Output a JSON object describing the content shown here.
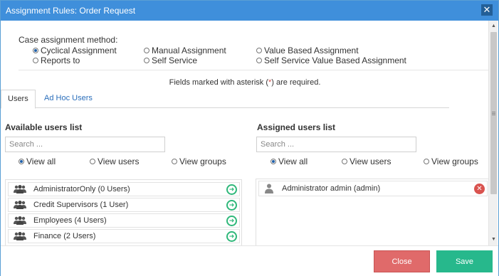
{
  "dialog": {
    "title": "Assignment Rules: Order Request",
    "close_glyph": "✕"
  },
  "method": {
    "label": "Case assignment method:",
    "options": [
      {
        "label": "Cyclical Assignment",
        "checked": true
      },
      {
        "label": "Manual Assignment",
        "checked": false
      },
      {
        "label": "Value Based Assignment",
        "checked": false
      },
      {
        "label": "Reports to",
        "checked": false
      },
      {
        "label": "Self Service",
        "checked": false
      },
      {
        "label": "Self Service Value Based Assignment",
        "checked": false
      }
    ]
  },
  "required_note": {
    "before": "Fields marked with asterisk (",
    "asterisk": "*",
    "after": ") are required."
  },
  "tabs": [
    {
      "label": "Users",
      "active": true
    },
    {
      "label": "Ad Hoc Users",
      "active": false
    }
  ],
  "available": {
    "title": "Available users list",
    "search_placeholder": "Search ...",
    "filters": [
      {
        "label": "View all",
        "checked": true
      },
      {
        "label": "View users",
        "checked": false
      },
      {
        "label": "View groups",
        "checked": false
      }
    ],
    "items": [
      {
        "label": "AdministratorOnly (0 Users)",
        "icon": "users-group-icon"
      },
      {
        "label": "Credit Supervisors (1 User)",
        "icon": "users-group-icon"
      },
      {
        "label": "Employees (4 Users)",
        "icon": "users-group-icon"
      },
      {
        "label": "Finance (2 Users)",
        "icon": "users-group-icon"
      }
    ],
    "add_glyph": "➜"
  },
  "assigned": {
    "title": "Assigned users list",
    "search_placeholder": "Search ...",
    "filters": [
      {
        "label": "View all",
        "checked": true
      },
      {
        "label": "View users",
        "checked": false
      },
      {
        "label": "View groups",
        "checked": false
      }
    ],
    "items": [
      {
        "label": "Administrator admin (admin)",
        "icon": "user-icon"
      }
    ],
    "remove_glyph": "✕"
  },
  "scrollbar": {
    "up_glyph": "▲",
    "down_glyph": "▼"
  },
  "footer": {
    "close_label": "Close",
    "save_label": "Save"
  },
  "colors": {
    "titlebar": "#3f8fdb",
    "close_button": "#e06a6a",
    "save_button": "#27b88c",
    "add_arrow": "#2fb87a",
    "remove_button": "#d9534f",
    "link": "#2a6ebb"
  }
}
